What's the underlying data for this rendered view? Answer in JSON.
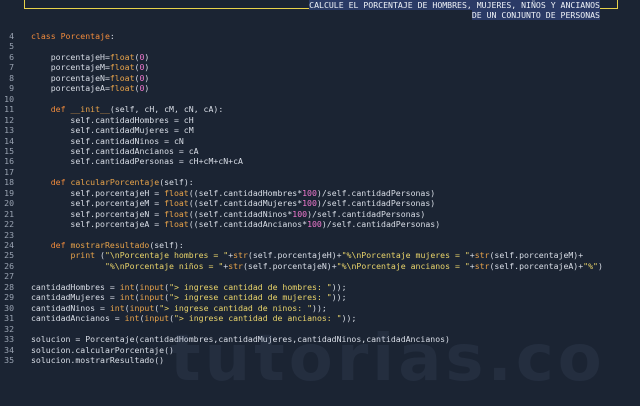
{
  "banner": {
    "line1": "CALCULE EL PORCENTAJE DE HOMBRES, MUJERES, NIÑOS Y ANCIANOS",
    "line2": "DE UN CONJUNTO DE PERSONAS"
  },
  "watermark": "tutorias.co",
  "code_lines": [
    {
      "n": "4",
      "t": "class Porcentaje:"
    },
    {
      "n": "5",
      "t": ""
    },
    {
      "n": "6",
      "t": "    porcentajeH=float(0)"
    },
    {
      "n": "7",
      "t": "    porcentajeM=float(0)"
    },
    {
      "n": "8",
      "t": "    porcentajeN=float(0)"
    },
    {
      "n": "9",
      "t": "    porcentajeA=float(0)"
    },
    {
      "n": "10",
      "t": ""
    },
    {
      "n": "11",
      "t": "    def __init__(self, cH, cM, cN, cA):"
    },
    {
      "n": "12",
      "t": "        self.cantidadHombres = cH"
    },
    {
      "n": "13",
      "t": "        self.cantidadMujeres = cM"
    },
    {
      "n": "14",
      "t": "        self.cantidadNinos = cN"
    },
    {
      "n": "15",
      "t": "        self.cantidadAncianos = cA"
    },
    {
      "n": "16",
      "t": "        self.cantidadPersonas = cH+cM+cN+cA"
    },
    {
      "n": "17",
      "t": ""
    },
    {
      "n": "18",
      "t": "    def calcularPorcentaje(self):"
    },
    {
      "n": "19",
      "t": "        self.porcentajeH = float((self.cantidadHombres*100)/self.cantidadPersonas)"
    },
    {
      "n": "20",
      "t": "        self.porcentajeM = float((self.cantidadMujeres*100)/self.cantidadPersonas)"
    },
    {
      "n": "21",
      "t": "        self.porcentajeN = float((self.cantidadNinos*100)/self.cantidadPersonas)"
    },
    {
      "n": "22",
      "t": "        self.porcentajeA = float((self.cantidadAncianos*100)/self.cantidadPersonas)"
    },
    {
      "n": "23",
      "t": ""
    },
    {
      "n": "24",
      "t": "    def mostrarResultado(self):"
    },
    {
      "n": "25",
      "t": "        print (\"\\nPorcentaje hombres = \"+str(self.porcentajeH)+\"%\\nPorcentaje mujeres = \"+str(self.porcentajeM)+"
    },
    {
      "n": "26",
      "t": "               \"%\\nPorcentaje niños = \"+str(self.porcentajeN)+\"%\\nPorcentaje ancianos = \"+str(self.porcentajeA)+\"%\")"
    },
    {
      "n": "27",
      "t": ""
    },
    {
      "n": "28",
      "t": "cantidadHombres = int(input(\"> ingrese cantidad de hombres: \"));"
    },
    {
      "n": "29",
      "t": "cantidadMujeres = int(input(\"> ingrese cantidad de mujeres: \"));"
    },
    {
      "n": "30",
      "t": "cantidadNinos = int(input(\"> ingrese cantidad de ninos: \"));"
    },
    {
      "n": "31",
      "t": "cantidadAncianos = int(input(\"> ingrese cantidad de ancianos: \"));"
    },
    {
      "n": "32",
      "t": ""
    },
    {
      "n": "33",
      "t": "solucion = Porcentaje(cantidadHombres,cantidadMujeres,cantidadNinos,cantidadAncianos)"
    },
    {
      "n": "34",
      "t": "solucion.calcularPorcentaje()"
    },
    {
      "n": "35",
      "t": "solucion.mostrarResultado()"
    }
  ]
}
